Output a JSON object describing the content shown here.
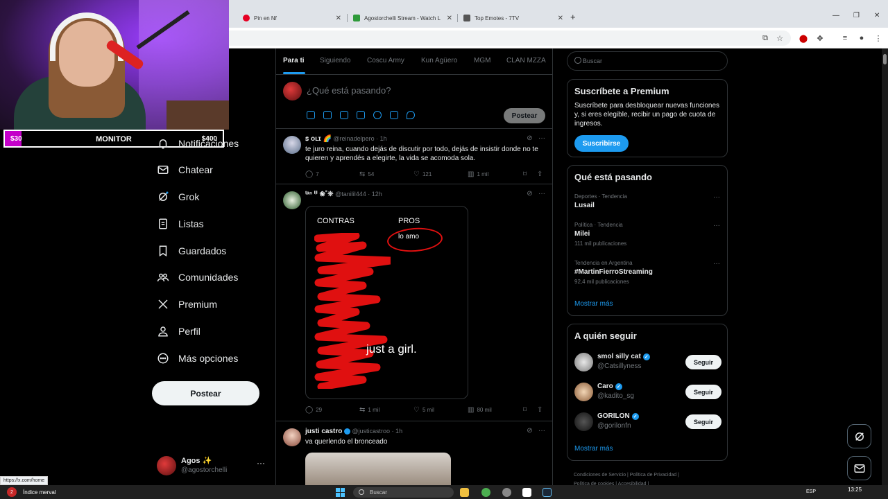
{
  "browser": {
    "tabs": [
      {
        "title": "Pin en Nf",
        "color": "#e60023"
      },
      {
        "title": "Agostorchelli Stream - Watch L",
        "color": "#2e9a3a"
      },
      {
        "title": "Top Emotes - 7TV",
        "color": "#555555"
      }
    ],
    "status_url": "https://x.com/home"
  },
  "stream": {
    "goal_min": "$30",
    "goal_label": "MONITOR",
    "goal_max": "$400",
    "goal_color": "#c400c9"
  },
  "nav": {
    "items": [
      {
        "label": "Notificaciones",
        "icon": "bell-icon"
      },
      {
        "label": "Chatear",
        "icon": "mail-icon"
      },
      {
        "label": "Grok",
        "icon": "grok-icon"
      },
      {
        "label": "Listas",
        "icon": "list-icon"
      },
      {
        "label": "Guardados",
        "icon": "bookmark-icon"
      },
      {
        "label": "Comunidades",
        "icon": "people-icon"
      },
      {
        "label": "Premium",
        "icon": "x-logo-icon"
      },
      {
        "label": "Perfil",
        "icon": "person-icon"
      },
      {
        "label": "Más opciones",
        "icon": "more-circle-icon"
      }
    ],
    "post_label": "Postear",
    "account": {
      "name": "Agos ✨",
      "handle": "@agostorchelli",
      "more": "···"
    }
  },
  "feed": {
    "tabs": [
      "Para ti",
      "Siguiendo",
      "Coscu Army",
      "Kun Agüero",
      "MGM",
      "CLAN MZZA"
    ],
    "accent": "#1d9bf0",
    "composer": {
      "placeholder": "¿Qué está pasando?",
      "button": "Postear"
    },
    "tweets": [
      {
        "name": "ꜱ ᴏʟɪ 🌈",
        "handle": "@reinadelpero",
        "time": "· 1h",
        "text": "te juro reina, cuando dejás de discutir por todo, dejás de insistir donde no te quieren y aprendés a elegirte, la vida se acomoda sola.",
        "replies": "7",
        "reposts": "54",
        "likes": "121",
        "views": "1 mil"
      },
      {
        "name": "ᵗᵃⁿ ⁱˡⁱ ❀˚❊",
        "handle": "@tanilil444",
        "time": "· 12h",
        "media": {
          "contras": "CONTRAS",
          "pros": "PROS",
          "pro_item": "lo amo",
          "overlay": "just a girl."
        },
        "replies": "29",
        "reposts": "1 mil",
        "likes": "5 mil",
        "views": "80 mil"
      },
      {
        "name": "justi castro",
        "handle": "@justicastroo",
        "time": "· 1h",
        "text": "va querlendo el bronceado"
      }
    ]
  },
  "sidebar": {
    "search_placeholder": "Buscar",
    "premium": {
      "title": "Suscríbete a Premium",
      "desc": "Suscríbete para desbloquear nuevas funciones y, si eres elegible, recibir un pago de cuota de ingresos.",
      "button": "Suscribirse"
    },
    "trends": {
      "title": "Qué está pasando",
      "items": [
        {
          "category": "Deportes · Tendencia",
          "name": "Lusail",
          "count": ""
        },
        {
          "category": "Política · Tendencia",
          "name": "Milei",
          "count": "111 mil publicaciones"
        },
        {
          "category": "Tendencia en Argentina",
          "name": "#MartinFierroStreaming",
          "count": "92,4 mil publicaciones"
        }
      ],
      "more": "Mostrar más"
    },
    "follow": {
      "title": "A quién seguir",
      "items": [
        {
          "name": "smol silly cat",
          "handle": "@Catsillyness",
          "button": "Seguir"
        },
        {
          "name": "Caro",
          "handle": "@kadito_sg",
          "button": "Seguir"
        },
        {
          "name": "GORILON",
          "handle": "@gorilonfn",
          "button": "Seguir"
        }
      ],
      "more": "Mostrar más"
    },
    "footer": {
      "line1": "Condiciones de Servicio  |  Política de Privacidad  |",
      "line2": "Política de cookies  |  Accesibilidad  |"
    }
  },
  "taskbar": {
    "weather_badge": "2",
    "weather_text": "Índice merval",
    "search": "Buscar",
    "lang": "ESP",
    "time": "13:25"
  }
}
